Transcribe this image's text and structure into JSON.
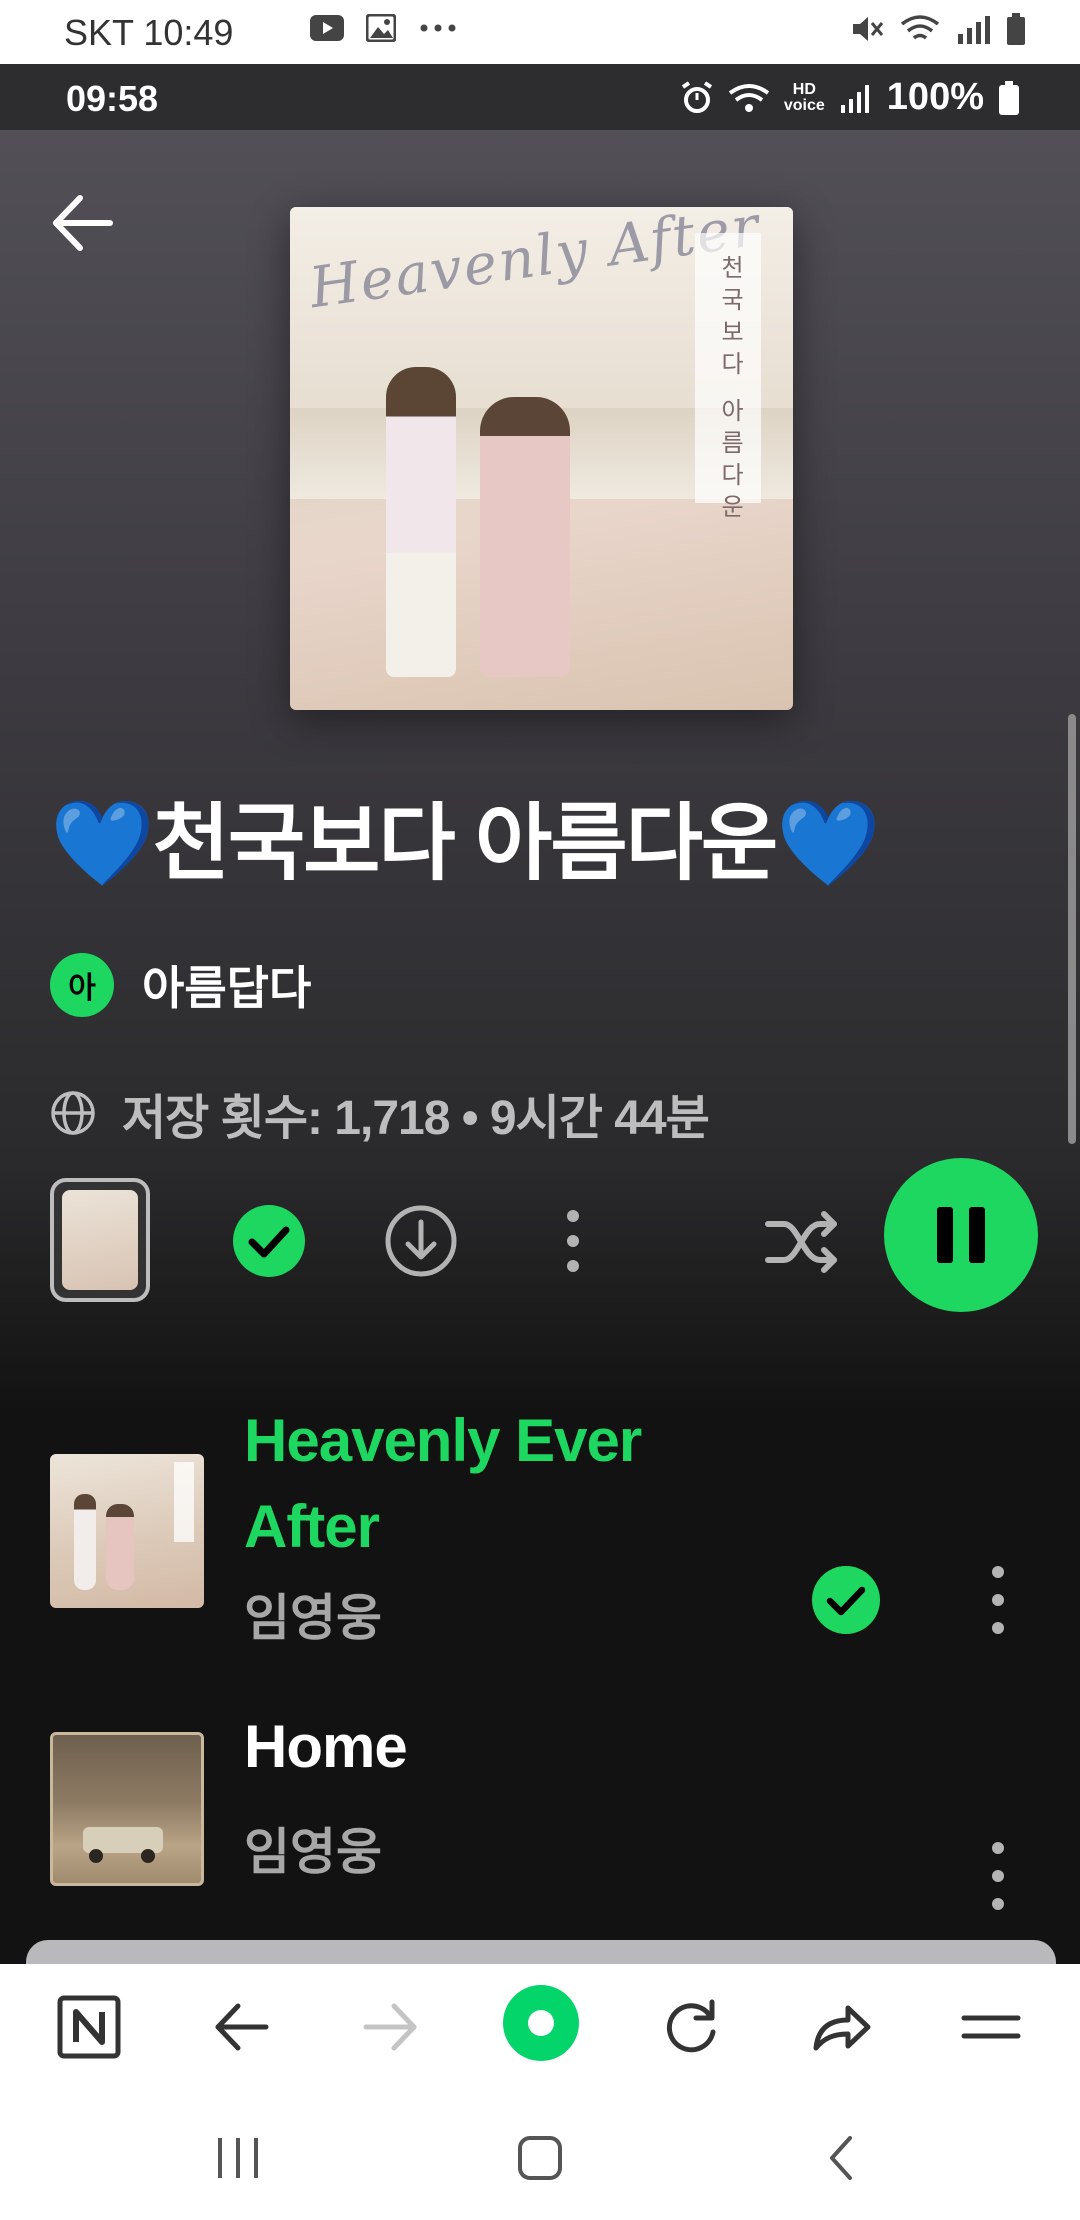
{
  "device_status": {
    "carrier_time": "SKT 10:49",
    "notification_icons": [
      "youtube-icon",
      "gallery-icon",
      "more-notifications-icon"
    ],
    "status_icons": [
      "mute-icon",
      "wifi-icon",
      "signal-icon",
      "battery-icon"
    ]
  },
  "app_status": {
    "time": "09:58",
    "battery": "100%",
    "hd_label": "HD",
    "voice_label": "voice"
  },
  "cover": {
    "script_title": "Heavenly After",
    "vertical_text": "천국보다 아름다운"
  },
  "playlist": {
    "title": "💙천국보다 아름다운💙",
    "owner_initial": "아",
    "owner_name": "아름답다",
    "meta": "저장 횟수: 1,718 • 9시간 44분"
  },
  "colors": {
    "accent": "#1ed760",
    "background": "#121212",
    "text_secondary": "#a7a7a7"
  },
  "tracks": [
    {
      "title_line1": "Heavenly Ever",
      "title_line2": "After",
      "artist": "임영웅",
      "playing": true,
      "saved": true
    },
    {
      "title_line1": "Home",
      "title_line2": "",
      "artist": "임영웅",
      "playing": false,
      "saved": false
    }
  ],
  "toolbar": {
    "items": [
      "naver-home-icon",
      "back-icon",
      "forward-icon",
      "green-dot-home-icon",
      "refresh-icon",
      "share-icon",
      "menu-icon"
    ]
  },
  "system_nav": {
    "items": [
      "recent-apps-icon",
      "home-icon",
      "back-icon"
    ]
  }
}
